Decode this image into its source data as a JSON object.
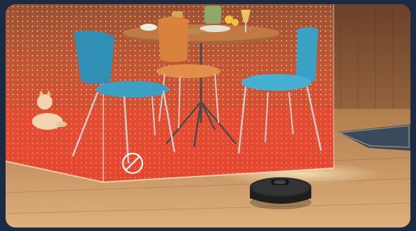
{
  "scene": {
    "subject": "robot-vacuum-no-go-zone",
    "elements": [
      "dining-table",
      "chair-blue-left",
      "chair-orange-center",
      "chair-blue-right",
      "cat",
      "robot-vacuum",
      "rug",
      "no-go-zone-box",
      "no-go-icon"
    ]
  },
  "colors": {
    "frame": "#1c2b44",
    "wall_wood": "#8a5a36",
    "floor_wood": "#c89a66",
    "zone_red": "#e8402a",
    "zone_orange": "#f07a3a",
    "chair_blue": "#2f8fb5",
    "chair_orange": "#d9823e",
    "table_top": "#a8653a",
    "vacuum": "#222222",
    "rug": "#3a4a5c"
  },
  "icons": {
    "no_go": "prohibited-icon"
  }
}
